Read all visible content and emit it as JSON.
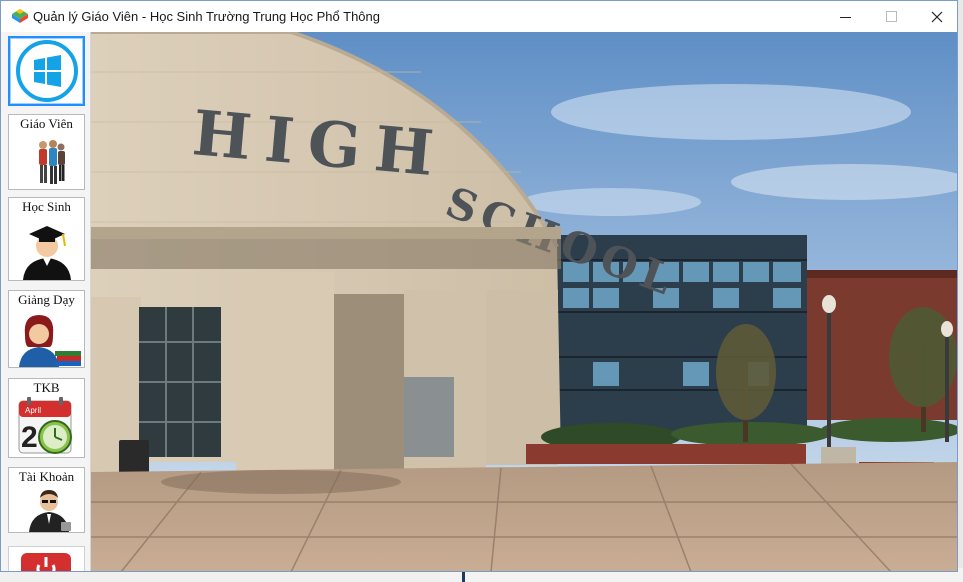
{
  "window": {
    "title": "Quản lý Giáo Viên - Học Sinh Trường Trung Học Phổ Thông"
  },
  "sidebar": {
    "items": [
      {
        "label": "",
        "icon": "windows-start-icon"
      },
      {
        "label": "Giáo Viên",
        "icon": "teachers-icon"
      },
      {
        "label": "Học Sinh",
        "icon": "graduate-student-icon"
      },
      {
        "label": "Giảng Dạy",
        "icon": "teacher-with-books-icon"
      },
      {
        "label": "TKB",
        "icon": "calendar-clock-icon"
      },
      {
        "label": "Tài Khoản",
        "icon": "account-user-icon"
      },
      {
        "label": "",
        "icon": "power-icon"
      }
    ]
  },
  "hero": {
    "building_text_1": "HIGH",
    "building_text_2": "SCHOOL"
  },
  "colors": {
    "accent": "#1e90ff",
    "sky": "#6f9fd0",
    "building": "#d9cbb3",
    "brick": "#7a3b2e",
    "power_red": "#d32f2f"
  }
}
